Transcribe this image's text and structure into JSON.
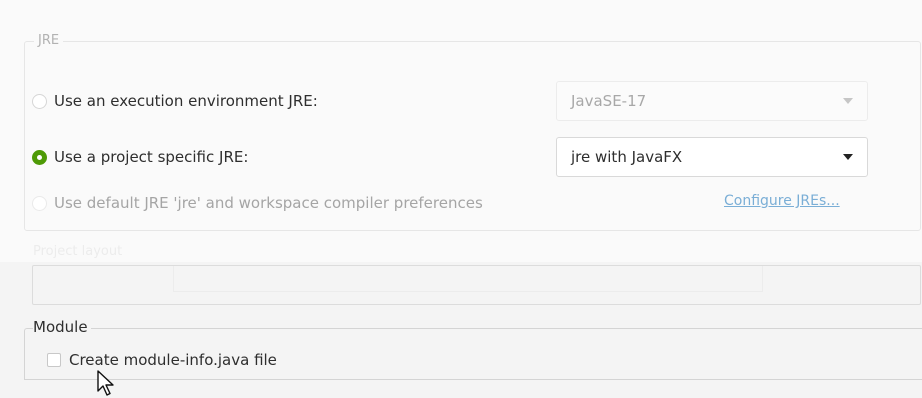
{
  "jre_group": {
    "legend": "JRE",
    "options": [
      {
        "label": "Use an execution environment JRE:",
        "selected": false,
        "enabled": true
      },
      {
        "label": "Use a project specific JRE:",
        "selected": true,
        "enabled": true
      },
      {
        "label": "Use default JRE 'jre' and workspace compiler preferences",
        "selected": false,
        "enabled": false
      }
    ],
    "execution_env_combo": {
      "value": "JavaSE-17",
      "enabled": false
    },
    "project_jre_combo": {
      "value": "jre with JavaFX",
      "enabled": true
    },
    "configure_link": "Configure JREs..."
  },
  "project_layout": {
    "legend": "Project layout"
  },
  "module_group": {
    "legend": "Module",
    "create_module_info": {
      "label": "Create module-info.java file",
      "checked": false
    }
  },
  "colors": {
    "radio_checked": "#4e9a06",
    "link": "#7aaed6",
    "disabled_text": "#a5a5a5"
  }
}
